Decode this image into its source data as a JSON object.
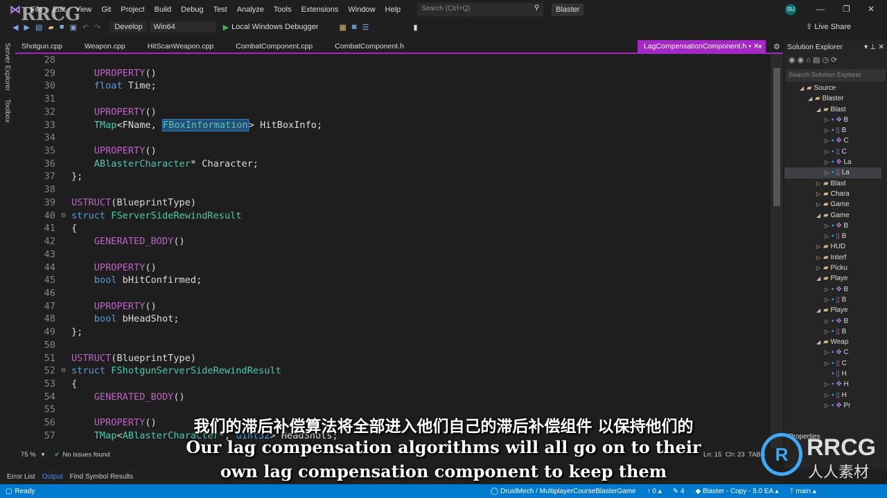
{
  "menu": {
    "items": [
      "File",
      "Edit",
      "View",
      "Git",
      "Project",
      "Build",
      "Debug",
      "Test",
      "Analyze",
      "Tools",
      "Extensions",
      "Window",
      "Help"
    ],
    "search_placeholder": "Search (Ctrl+Q)",
    "solution": "Blaster",
    "avatar": "SU"
  },
  "toolbar": {
    "config": "Develop",
    "platform": "Win64",
    "debugger": "Local Windows Debugger",
    "live_share": "Live Share"
  },
  "side_tools": [
    "Server Explorer",
    "Toolbox"
  ],
  "tabs": [
    "Shotgun.cpp",
    "Weapon.cpp",
    "HitScanWeapon.cpp",
    "CombatComponent.cpp",
    "CombatComponent.h"
  ],
  "active_tab": "LagCompensationComponent.h",
  "code": [
    {
      "n": "28",
      "f": "",
      "s": []
    },
    {
      "n": "29",
      "f": "",
      "s": [
        [
          "    ",
          ""
        ],
        [
          "UPROPERTY",
          "m"
        ],
        [
          "()",
          ""
        ]
      ]
    },
    {
      "n": "30",
      "f": "",
      "s": [
        [
          "    ",
          ""
        ],
        [
          "float",
          "k"
        ],
        [
          " Time;",
          ""
        ]
      ]
    },
    {
      "n": "31",
      "f": "",
      "s": []
    },
    {
      "n": "32",
      "f": "",
      "s": [
        [
          "    ",
          ""
        ],
        [
          "UPROPERTY",
          "m"
        ],
        [
          "()",
          ""
        ]
      ]
    },
    {
      "n": "33",
      "f": "",
      "s": [
        [
          "    ",
          ""
        ],
        [
          "TMap",
          "t"
        ],
        [
          "<FName, ",
          ""
        ],
        [
          "FBoxInformation",
          "t hl"
        ],
        [
          "> HitBoxInfo;",
          ""
        ]
      ]
    },
    {
      "n": "34",
      "f": "",
      "s": []
    },
    {
      "n": "35",
      "f": "",
      "s": [
        [
          "    ",
          ""
        ],
        [
          "UPROPERTY",
          "m"
        ],
        [
          "()",
          ""
        ]
      ]
    },
    {
      "n": "36",
      "f": "",
      "s": [
        [
          "    ",
          ""
        ],
        [
          "ABlasterCharacter",
          "t"
        ],
        [
          "* Character;",
          ""
        ]
      ]
    },
    {
      "n": "37",
      "f": "",
      "s": [
        [
          "};",
          ""
        ]
      ]
    },
    {
      "n": "38",
      "f": "",
      "s": []
    },
    {
      "n": "39",
      "f": "",
      "s": [
        [
          "USTRUCT",
          "m"
        ],
        [
          "(BlueprintType)",
          ""
        ]
      ]
    },
    {
      "n": "40",
      "f": "⊟",
      "s": [
        [
          "struct",
          "k"
        ],
        [
          " ",
          ""
        ],
        [
          "FServerSideRewindResult",
          "t"
        ]
      ]
    },
    {
      "n": "41",
      "f": "",
      "s": [
        [
          "{",
          ""
        ]
      ]
    },
    {
      "n": "42",
      "f": "",
      "s": [
        [
          "    ",
          ""
        ],
        [
          "GENERATED_BODY",
          "m"
        ],
        [
          "()",
          ""
        ]
      ]
    },
    {
      "n": "43",
      "f": "",
      "s": []
    },
    {
      "n": "44",
      "f": "",
      "s": [
        [
          "    ",
          ""
        ],
        [
          "UPROPERTY",
          "m"
        ],
        [
          "()",
          ""
        ]
      ]
    },
    {
      "n": "45",
      "f": "",
      "s": [
        [
          "    ",
          ""
        ],
        [
          "bool",
          "k"
        ],
        [
          " bHitConfirmed;",
          ""
        ]
      ]
    },
    {
      "n": "46",
      "f": "",
      "s": []
    },
    {
      "n": "47",
      "f": "",
      "s": [
        [
          "    ",
          ""
        ],
        [
          "UPROPERTY",
          "m"
        ],
        [
          "()",
          ""
        ]
      ]
    },
    {
      "n": "48",
      "f": "",
      "s": [
        [
          "    ",
          ""
        ],
        [
          "bool",
          "k"
        ],
        [
          " bHeadShot;",
          ""
        ]
      ]
    },
    {
      "n": "49",
      "f": "",
      "s": [
        [
          "};",
          ""
        ]
      ]
    },
    {
      "n": "50",
      "f": "",
      "s": []
    },
    {
      "n": "51",
      "f": "",
      "s": [
        [
          "USTRUCT",
          "m"
        ],
        [
          "(BlueprintType)",
          ""
        ]
      ]
    },
    {
      "n": "52",
      "f": "⊟",
      "s": [
        [
          "struct",
          "k"
        ],
        [
          " ",
          ""
        ],
        [
          "FShotgunServerSideRewindResult",
          "t"
        ]
      ]
    },
    {
      "n": "53",
      "f": "",
      "s": [
        [
          "{",
          ""
        ]
      ]
    },
    {
      "n": "54",
      "f": "",
      "s": [
        [
          "    ",
          ""
        ],
        [
          "GENERATED_BODY",
          "m"
        ],
        [
          "()",
          ""
        ]
      ]
    },
    {
      "n": "55",
      "f": "",
      "s": []
    },
    {
      "n": "56",
      "f": "",
      "s": [
        [
          "    ",
          ""
        ],
        [
          "UPROPERTY",
          "m"
        ],
        [
          "()",
          ""
        ]
      ]
    },
    {
      "n": "57",
      "f": "",
      "s": [
        [
          "    ",
          ""
        ],
        [
          "TMap",
          "t"
        ],
        [
          "<",
          ""
        ],
        [
          "ABlasterCharacter",
          "t"
        ],
        [
          "*, ",
          ""
        ],
        [
          "uint32",
          "k"
        ],
        [
          "> HeadShots;",
          ""
        ]
      ]
    }
  ],
  "solution_explorer": {
    "title": "Solution Explorer",
    "search_placeholder": "Search Solution Explorer",
    "items": [
      {
        "l": 0,
        "e": "open",
        "i": "folder",
        "t": "Source"
      },
      {
        "l": 1,
        "e": "open",
        "i": "folder",
        "t": "Blaster"
      },
      {
        "l": 2,
        "e": "open",
        "i": "folder",
        "t": "Blast"
      },
      {
        "l": 3,
        "e": "closed",
        "i": "cpp",
        "t": "B"
      },
      {
        "l": 3,
        "e": "closed",
        "i": "h",
        "t": "B"
      },
      {
        "l": 3,
        "e": "closed",
        "i": "cpp",
        "t": "C"
      },
      {
        "l": 3,
        "e": "closed",
        "i": "h",
        "t": "C"
      },
      {
        "l": 3,
        "e": "closed",
        "i": "cpp",
        "t": "La"
      },
      {
        "l": 3,
        "e": "closed",
        "i": "h",
        "t": "La",
        "sel": true
      },
      {
        "l": 2,
        "e": "closed",
        "i": "folder",
        "t": "Blast"
      },
      {
        "l": 2,
        "e": "closed",
        "i": "folder",
        "t": "Chara"
      },
      {
        "l": 2,
        "e": "closed",
        "i": "folder",
        "t": "Game"
      },
      {
        "l": 2,
        "e": "open",
        "i": "folder",
        "t": "Game"
      },
      {
        "l": 3,
        "e": "closed",
        "i": "cpp",
        "t": "B"
      },
      {
        "l": 3,
        "e": "closed",
        "i": "h",
        "t": "B"
      },
      {
        "l": 2,
        "e": "closed",
        "i": "folder",
        "t": "HUD"
      },
      {
        "l": 2,
        "e": "closed",
        "i": "folder",
        "t": "Interf"
      },
      {
        "l": 2,
        "e": "closed",
        "i": "folder",
        "t": "Picku"
      },
      {
        "l": 2,
        "e": "open",
        "i": "folder",
        "t": "Playe"
      },
      {
        "l": 3,
        "e": "closed",
        "i": "cpp",
        "t": "B"
      },
      {
        "l": 3,
        "e": "closed",
        "i": "h",
        "t": "B"
      },
      {
        "l": 2,
        "e": "open",
        "i": "folder",
        "t": "Playe"
      },
      {
        "l": 3,
        "e": "closed",
        "i": "cpp",
        "t": "B"
      },
      {
        "l": 3,
        "e": "closed",
        "i": "h",
        "t": "B"
      },
      {
        "l": 2,
        "e": "open",
        "i": "folder",
        "t": "Weap"
      },
      {
        "l": 3,
        "e": "closed",
        "i": "cpp",
        "t": "C"
      },
      {
        "l": 3,
        "e": "closed",
        "i": "h",
        "t": "C"
      },
      {
        "l": 3,
        "e": "none",
        "i": "h",
        "t": "H"
      },
      {
        "l": 3,
        "e": "closed",
        "i": "cpp",
        "t": "H"
      },
      {
        "l": 3,
        "e": "closed",
        "i": "h",
        "t": "H"
      },
      {
        "l": 3,
        "e": "closed",
        "i": "cpp",
        "t": "Pr"
      }
    ]
  },
  "properties_title": "Properties",
  "infobar": {
    "zoom": "75 %",
    "issues": "No issues found",
    "line": "Ln: 15",
    "col": "Ch: 23",
    "tabs": "TABS"
  },
  "output_tabs": [
    "Error List",
    "Output",
    "Find Symbol Results"
  ],
  "status": {
    "ready": "Ready",
    "repo": "DruidMech / MultiplayerCourseBlasterGame",
    "up": "0",
    "edits": "4",
    "project": "Blaster - Copy - 5.0 EA",
    "branch": "main"
  },
  "subtitles": {
    "zh": "我们的滞后补偿算法将全部进入他们自己的滞后补偿组件 以保持他们的",
    "en1": "Our lag compensation algorithms will all go on to their",
    "en2": "own lag compensation component to keep them"
  },
  "watermark": {
    "text": "RRCG",
    "cn": "人人素材"
  }
}
